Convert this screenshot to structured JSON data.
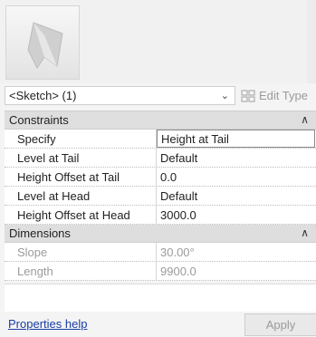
{
  "type_selector": {
    "value": "<Sketch> (1)",
    "edit_type_label": "Edit Type"
  },
  "groups": [
    {
      "title": "Constraints",
      "rows": [
        {
          "name": "Specify",
          "value": "Height at Tail"
        },
        {
          "name": "Level at Tail",
          "value": "Default"
        },
        {
          "name": "Height Offset at Tail",
          "value": "0.0"
        },
        {
          "name": "Level at Head",
          "value": "Default"
        },
        {
          "name": "Height Offset at Head",
          "value": "3000.0"
        }
      ]
    },
    {
      "title": "Dimensions",
      "rows": [
        {
          "name": "Slope",
          "value": "30.00°"
        },
        {
          "name": "Length",
          "value": "9900.0"
        }
      ]
    }
  ],
  "footer": {
    "help_label": "Properties help",
    "apply_label": "Apply"
  }
}
